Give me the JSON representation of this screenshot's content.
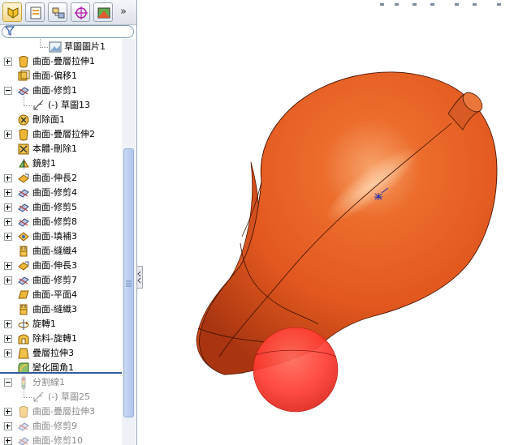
{
  "tabs": [
    {
      "name": "featuremanager-tab",
      "icon": "featuremanager-icon",
      "active": true
    },
    {
      "name": "propertymanager-tab",
      "icon": "propertymanager-icon"
    },
    {
      "name": "configurationmanager-tab",
      "icon": "configurationmanager-icon"
    },
    {
      "name": "dimxpert-tab",
      "icon": "dimxpert-icon"
    },
    {
      "name": "display-manager-tab",
      "icon": "display-manager-icon"
    }
  ],
  "more_tabs_glyph": "»",
  "filter": {
    "icon": "filter-icon",
    "value": ""
  },
  "tree": [
    {
      "label": "草圖圖片1",
      "icon": "sketch-picture-icon",
      "indent": 3
    },
    {
      "label": "曲面-疊層拉伸1",
      "icon": "surface-loft-icon",
      "indent": 1,
      "expander": "plus"
    },
    {
      "label": "曲面-偏移1",
      "icon": "surface-offset-icon",
      "indent": 1
    },
    {
      "label": "曲面-修剪1",
      "icon": "surface-trim-icon",
      "indent": 1,
      "expander": "minus"
    },
    {
      "label": "(-) 草圖13",
      "icon": "sketch-icon",
      "indent": 2
    },
    {
      "label": "刪除面1",
      "icon": "delete-face-icon",
      "indent": 1
    },
    {
      "label": "曲面-疊層拉伸2",
      "icon": "surface-loft-icon",
      "indent": 1,
      "expander": "plus"
    },
    {
      "label": "本體-刪除1",
      "icon": "body-delete-icon",
      "indent": 1
    },
    {
      "label": "鏡射1",
      "icon": "mirror-icon",
      "indent": 1
    },
    {
      "label": "曲面-伸長2",
      "icon": "surface-extend-icon",
      "indent": 1,
      "expander": "plus"
    },
    {
      "label": "曲面-修剪4",
      "icon": "surface-trim-icon",
      "indent": 1,
      "expander": "plus"
    },
    {
      "label": "曲面-修剪5",
      "icon": "surface-trim-icon",
      "indent": 1,
      "expander": "plus"
    },
    {
      "label": "曲面-修剪8",
      "icon": "surface-trim-icon",
      "indent": 1,
      "expander": "plus"
    },
    {
      "label": "曲面-填補3",
      "icon": "surface-fill-icon",
      "indent": 1,
      "expander": "plus"
    },
    {
      "label": "曲面-縫織4",
      "icon": "surface-knit-icon",
      "indent": 1
    },
    {
      "label": "曲面-伸長3",
      "icon": "surface-extend-icon",
      "indent": 1,
      "expander": "plus"
    },
    {
      "label": "曲面-修剪7",
      "icon": "surface-trim-icon",
      "indent": 1,
      "expander": "plus"
    },
    {
      "label": "曲面-平面4",
      "icon": "planar-surface-icon",
      "indent": 1
    },
    {
      "label": "曲面-縫織3",
      "icon": "surface-knit-icon",
      "indent": 1
    },
    {
      "label": "旋轉1",
      "icon": "revolve-icon",
      "indent": 1,
      "expander": "plus"
    },
    {
      "label": "除料-旋轉1",
      "icon": "cut-revolve-icon",
      "indent": 1,
      "expander": "plus"
    },
    {
      "label": "疊層拉伸3",
      "icon": "loft-icon",
      "indent": 1,
      "expander": "plus"
    },
    {
      "label": "變化圓角1",
      "icon": "variable-fillet-icon",
      "indent": 1
    },
    {
      "label": "分割線1",
      "icon": "split-line-icon",
      "indent": 1,
      "expander": "minus",
      "suppressed": true
    },
    {
      "label": "(-) 草圖25",
      "icon": "sketch-icon",
      "indent": 2,
      "suppressed": true
    },
    {
      "label": "曲面-疊層拉伸3",
      "icon": "surface-loft-icon",
      "indent": 1,
      "expander": "plus",
      "suppressed": true
    },
    {
      "label": "曲面-修剪9",
      "icon": "surface-trim-icon",
      "indent": 1,
      "expander": "plus",
      "suppressed": true
    },
    {
      "label": "曲面-修剪10",
      "icon": "surface-trim-icon",
      "indent": 1,
      "expander": "plus",
      "suppressed": true
    }
  ],
  "colors": {
    "model_body": "#e2581f",
    "model_highlight": "#f7a36a",
    "model_shadow": "#a83510",
    "split_sphere": "#ff3b30",
    "selection_blue": "#2f5b9c"
  }
}
